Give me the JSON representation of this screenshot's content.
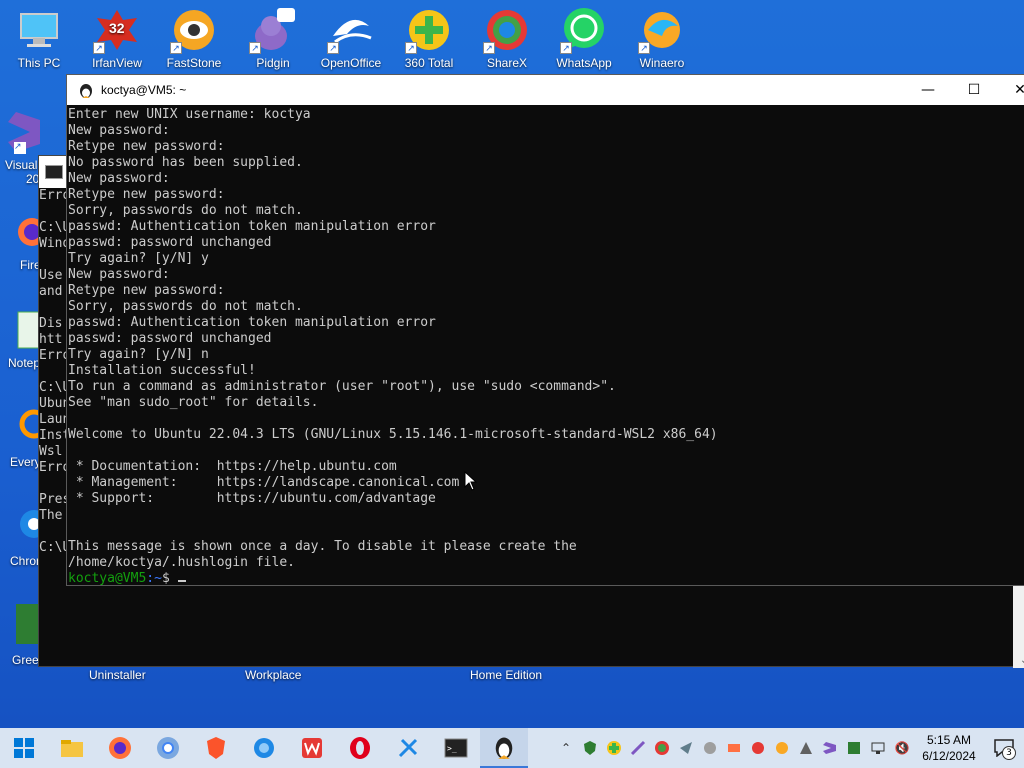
{
  "desktop_icons": [
    {
      "label": "This PC",
      "icon": "this-pc-icon"
    },
    {
      "label": "IrfanView",
      "icon": "irfanview-icon",
      "badge": "32"
    },
    {
      "label": "FastStone",
      "icon": "faststone-icon"
    },
    {
      "label": "Pidgin",
      "icon": "pidgin-icon"
    },
    {
      "label": "OpenOffice",
      "icon": "openoffice-icon"
    },
    {
      "label": "360 Total",
      "icon": "360-total-icon"
    },
    {
      "label": "ShareX",
      "icon": "sharex-icon"
    },
    {
      "label": "WhatsApp",
      "icon": "whatsapp-icon"
    },
    {
      "label": "Winaero",
      "icon": "winaero-icon"
    }
  ],
  "left_icon_labels": [
    "Visual",
    "20",
    "Fire",
    "Notep",
    "Every",
    "Chron",
    "Green"
  ],
  "below_labels": {
    "uninstaller": "Uninstaller",
    "workplace": "Workplace",
    "home_edition": "Home Edition"
  },
  "cmd_partial_lines": [
    "Erro",
    "",
    "C:\\U",
    "Wind",
    "",
    "Use",
    "and",
    "",
    "Dis",
    "htt",
    "Erro",
    "",
    "C:\\U",
    "Ubun",
    "Laun",
    "Inst",
    "Wsl",
    "Erro",
    "",
    "Pres",
    "The",
    "",
    "C:\\U"
  ],
  "terminal": {
    "title": "koctya@VM5: ~",
    "lines": [
      "Enter new UNIX username: koctya",
      "New password:",
      "Retype new password:",
      "No password has been supplied.",
      "New password:",
      "Retype new password:",
      "Sorry, passwords do not match.",
      "passwd: Authentication token manipulation error",
      "passwd: password unchanged",
      "Try again? [y/N] y",
      "New password:",
      "Retype new password:",
      "Sorry, passwords do not match.",
      "passwd: Authentication token manipulation error",
      "passwd: password unchanged",
      "Try again? [y/N] n",
      "Installation successful!",
      "To run a command as administrator (user \"root\"), use \"sudo <command>\".",
      "See \"man sudo_root\" for details.",
      "",
      "Welcome to Ubuntu 22.04.3 LTS (GNU/Linux 5.15.146.1-microsoft-standard-WSL2 x86_64)",
      "",
      " * Documentation:  https://help.ubuntu.com",
      " * Management:     https://landscape.canonical.com",
      " * Support:        https://ubuntu.com/advantage",
      "",
      "",
      "This message is shown once a day. To disable it please create the",
      "/home/koctya/.hushlogin file."
    ],
    "prompt_user": "koctya@VM5",
    "prompt_path": ":~",
    "prompt_symbol": "$"
  },
  "window_controls": {
    "minimize": "—",
    "maximize": "☐",
    "close": "✕"
  },
  "taskbar": {
    "apps": [
      "start-icon",
      "file-explorer-icon",
      "firefox-icon",
      "chrome-icon",
      "brave-icon",
      "network-icon",
      "wps-icon",
      "opera-icon",
      "snipping-icon",
      "terminal-icon",
      "ubuntu-icon"
    ],
    "clock_time": "5:15 AM",
    "clock_date": "6/12/2024",
    "notification_count": "3"
  },
  "colors": {
    "desktop": "#1a5fd0",
    "terminal_bg": "#0c0c0c",
    "terminal_fg": "#cccccc",
    "prompt_user": "#13a10e",
    "prompt_path": "#3b78ff",
    "taskbar": "#d9e4f2"
  }
}
